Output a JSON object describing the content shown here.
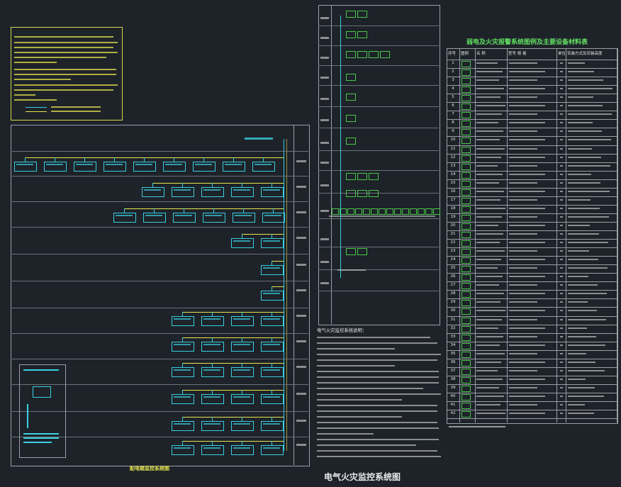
{
  "title_main": "电气火灾监控系统图",
  "title_left": "配电箱监控系统图",
  "table_title": "弱电及火灾报警系统图例及主要设备材料表",
  "table_headers": [
    "序号",
    "图例",
    "名 称",
    "型号 规 格",
    "单位",
    "安装方式及安装高度"
  ],
  "table_rows": [
    1,
    2,
    3,
    4,
    5,
    6,
    7,
    8,
    9,
    10,
    11,
    12,
    13,
    14,
    15,
    16,
    17,
    18,
    19,
    20,
    21,
    22,
    23,
    24,
    25,
    26,
    27,
    28,
    29,
    30,
    31,
    32,
    33,
    34,
    35,
    36,
    37,
    38,
    39,
    40,
    41,
    42
  ],
  "notes_title": "电气火灾监控系统说明：",
  "colors": {
    "background": "#1e2229",
    "cyan": "#38d0e0",
    "yellow": "#e6e64d",
    "green": "#48c848",
    "frame": "#9aa0a8"
  }
}
